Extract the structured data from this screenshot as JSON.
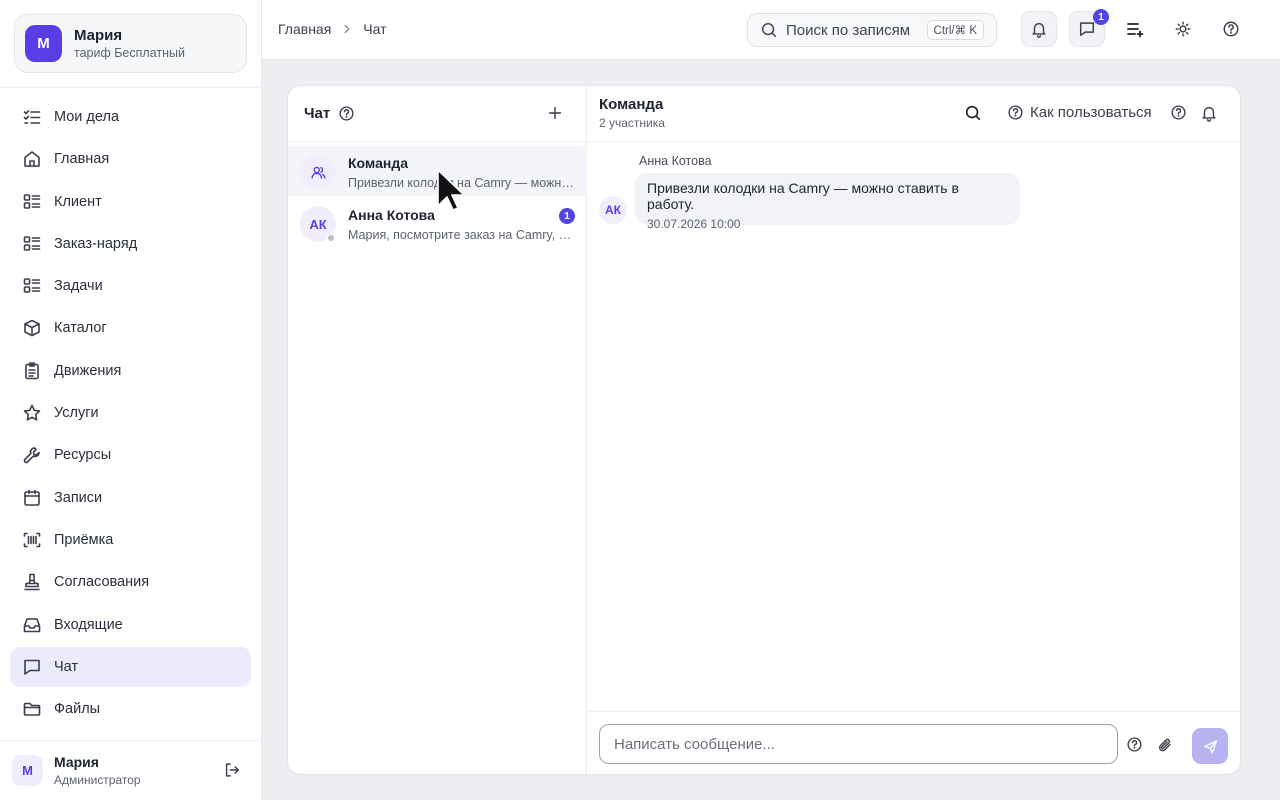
{
  "sidebar": {
    "account": {
      "initial": "М",
      "name": "Мария",
      "plan": "тариф Бесплатный"
    },
    "items": [
      {
        "label": "Мои дела",
        "icon": "list-check-icon"
      },
      {
        "label": "Главная",
        "icon": "home-icon"
      },
      {
        "label": "Клиент",
        "icon": "list-icon"
      },
      {
        "label": "Заказ-наряд",
        "icon": "list-icon"
      },
      {
        "label": "Задачи",
        "icon": "list-icon"
      },
      {
        "label": "Каталог",
        "icon": "box-icon"
      },
      {
        "label": "Движения",
        "icon": "clipboard-icon"
      },
      {
        "label": "Услуги",
        "icon": "star-icon"
      },
      {
        "label": "Ресурсы",
        "icon": "wrench-icon"
      },
      {
        "label": "Записи",
        "icon": "calendar-icon"
      },
      {
        "label": "Приёмка",
        "icon": "scan-icon"
      },
      {
        "label": "Согласования",
        "icon": "stamp-icon"
      },
      {
        "label": "Входящие",
        "icon": "inbox-icon"
      },
      {
        "label": "Чат",
        "icon": "chat-icon",
        "active": true
      },
      {
        "label": "Файлы",
        "icon": "folder-icon"
      }
    ],
    "footer": {
      "initial": "М",
      "name": "Мария",
      "role": "Администратор"
    }
  },
  "topbar": {
    "breadcrumb": [
      "Главная",
      "Чат"
    ],
    "search_placeholder": "Поиск по записям",
    "search_shortcut": "Ctrl/⌘ K",
    "chat_badge": "1"
  },
  "chat": {
    "list_title": "Чат",
    "conversations": [
      {
        "name": "Команда",
        "preview": "Привезли колодки на Camry — можно ставить в работу.",
        "type": "group",
        "selected": true
      },
      {
        "name": "Анна Котова",
        "initials": "АК",
        "preview": "Мария, посмотрите заказ на Camry, пожалуйста.",
        "unread": "1"
      }
    ],
    "active": {
      "title": "Команда",
      "subtitle": "2 участника",
      "howto_label": "Как пользоваться",
      "messages": [
        {
          "author": "Анна Котова",
          "initials": "АК",
          "text": "Привезли колодки на Camry — можно ставить в работу.",
          "time": "30.07.2026 10:00"
        }
      ]
    },
    "composer_placeholder": "Написать сообщение..."
  },
  "colors": {
    "accent": "#5b3de6",
    "active_nav_bg": "#ecebfd",
    "badge": "#4f46e5",
    "send_disabled": "#b9b3f2"
  }
}
